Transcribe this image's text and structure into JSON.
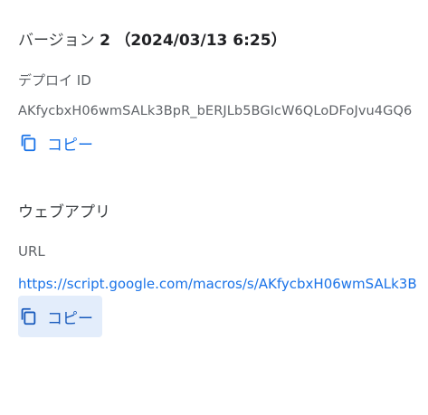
{
  "version": {
    "prefix": "バージョン",
    "number": "2",
    "date": "（2024/03/13 6:25）"
  },
  "deploy": {
    "label": "デプロイ ID",
    "id": "AKfycbxH06wmSALk3BpR_bERJLb5BGIcW6QLoDFoJvu4GQ6",
    "copy_label": "コピー",
    "copy_icon": "copy-icon"
  },
  "webapp": {
    "title": "ウェブアプリ",
    "url_label": "URL",
    "url": "https://script.google.com/macros/s/AKfycbxH06wmSALk3B",
    "copy_label": "コピー",
    "copy_icon": "copy-icon"
  },
  "colors": {
    "link": "#1a73e8",
    "hover_bg": "#e3edfb"
  }
}
